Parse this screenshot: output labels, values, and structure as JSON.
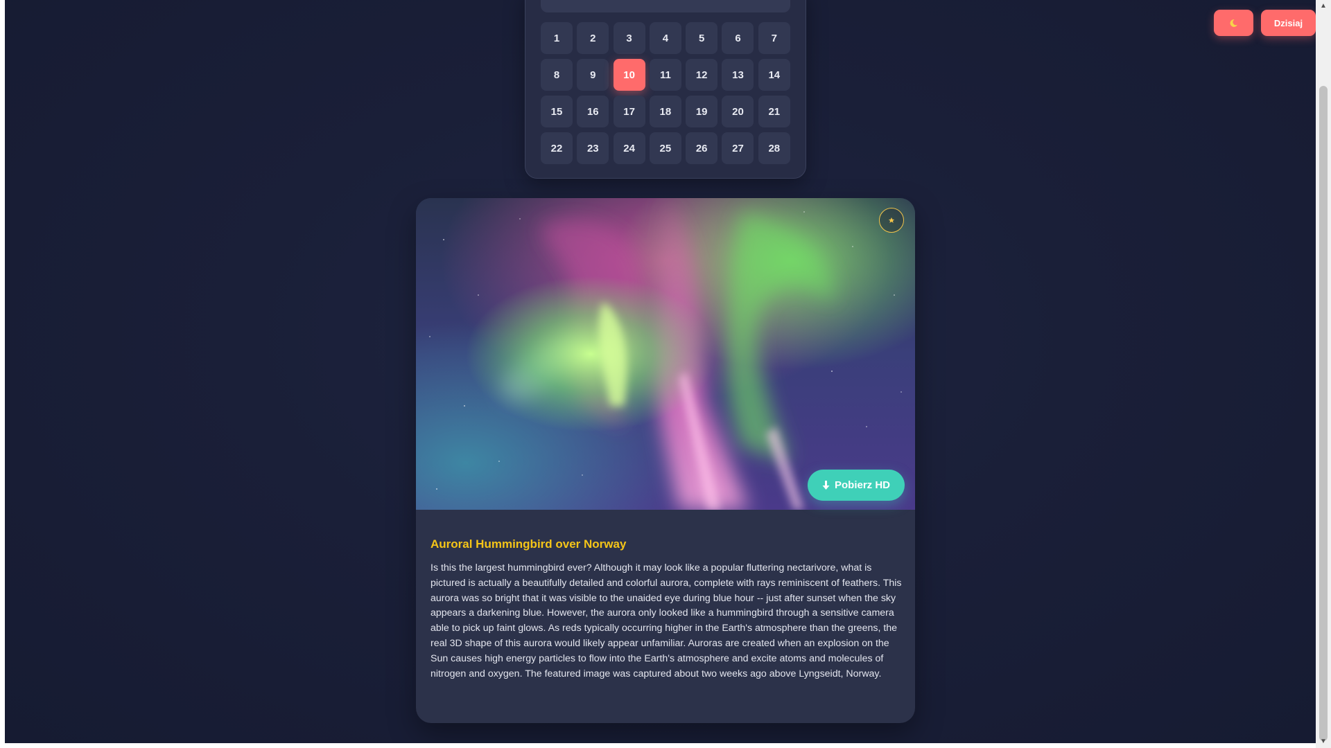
{
  "header": {
    "theme_toggle_icon": "moon-icon",
    "today_label": "Dzisiaj"
  },
  "calendar": {
    "days": [
      "1",
      "2",
      "3",
      "4",
      "5",
      "6",
      "7",
      "8",
      "9",
      "10",
      "11",
      "12",
      "13",
      "14",
      "15",
      "16",
      "17",
      "18",
      "19",
      "20",
      "21",
      "22",
      "23",
      "24",
      "25",
      "26",
      "27",
      "28"
    ],
    "selected_day": "10",
    "accent_color": "#ff6b6b"
  },
  "apod": {
    "image_alt_icon": "aurora-photo",
    "favorite_icon": "star-icon",
    "download_label": "Pobierz HD",
    "download_icon": "download-arrow-icon",
    "title": "Auroral Hummingbird over Norway",
    "explanation": "Is this the largest hummingbird ever? Although it may look like a popular fluttering nectarivore, what is pictured is actually a beautifully detailed and colorful aurora, complete with rays reminiscent of feathers. This aurora was so bright that it was visible to the unaided eye during blue hour -- just after sunset when the sky appears a darkening blue. However, the aurora only looked like a hummingbird through a sensitive camera able to pick up faint glows. As reds typically occurring higher in the Earth's atmosphere than the greens, the real 3D shape of this aurora would likely appear unfamiliar. Auroras are created when an explosion on the Sun causes high energy particles to flow into the Earth's atmosphere and excite atoms and molecules of nitrogen and oxygen. The featured image was captured about two weeks ago above Lyngseidt, Norway.",
    "title_color": "#f5c518",
    "download_color": "#3fd0b8"
  }
}
